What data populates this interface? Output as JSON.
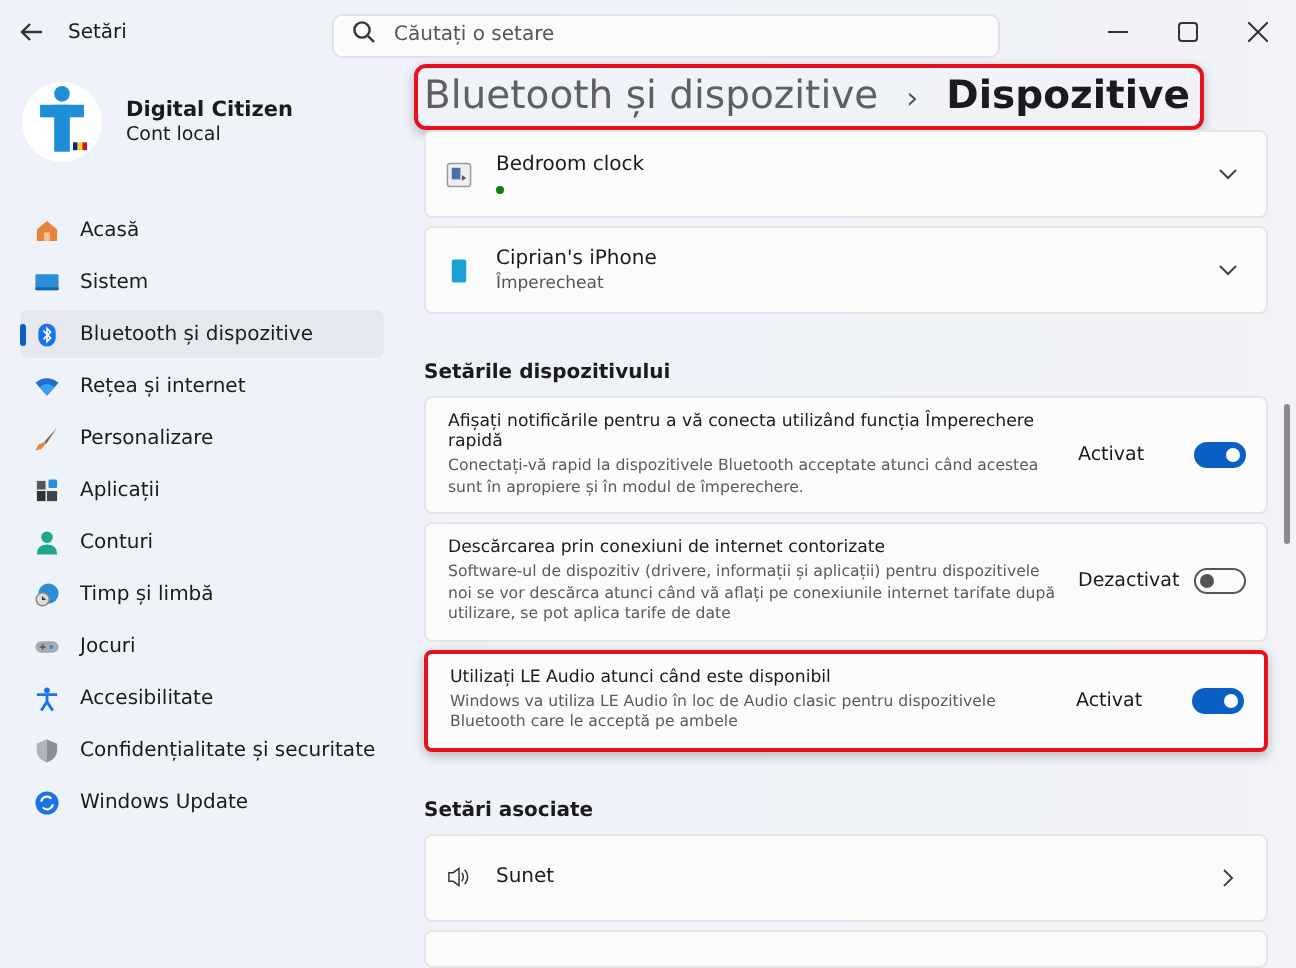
{
  "window": {
    "title": "Setări"
  },
  "search": {
    "placeholder": "Căutați o setare"
  },
  "profile": {
    "name": "Digital Citizen",
    "account": "Cont local"
  },
  "sidebar": {
    "items": [
      {
        "label": "Acasă",
        "kind": "home",
        "selected": false
      },
      {
        "label": "Sistem",
        "kind": "system",
        "selected": false
      },
      {
        "label": "Bluetooth și dispozitive",
        "kind": "bluetooth",
        "selected": true
      },
      {
        "label": "Rețea și internet",
        "kind": "wifi",
        "selected": false
      },
      {
        "label": "Personalizare",
        "kind": "brush",
        "selected": false
      },
      {
        "label": "Aplicații",
        "kind": "apps",
        "selected": false
      },
      {
        "label": "Conturi",
        "kind": "person",
        "selected": false
      },
      {
        "label": "Timp și limbă",
        "kind": "globe",
        "selected": false
      },
      {
        "label": "Jocuri",
        "kind": "gamepad",
        "selected": false
      },
      {
        "label": "Accesibilitate",
        "kind": "access",
        "selected": false
      },
      {
        "label": "Confidențialitate și securitate",
        "kind": "shield",
        "selected": false
      },
      {
        "label": "Windows Update",
        "kind": "update",
        "selected": false
      }
    ]
  },
  "breadcrumb": {
    "parent": "Bluetooth și dispozitive",
    "separator": "›",
    "current": "Dispozitive",
    "highlighted": true
  },
  "devices": [
    {
      "name": "Bedroom clock",
      "kind": "clock",
      "color": "#107c10"
    },
    {
      "name": "Ciprian's iPhone",
      "kind": "phone",
      "status": "Împerecheat"
    }
  ],
  "device_settings": {
    "heading": "Setările dispozitivului",
    "items": [
      {
        "title": "Afișați notificările pentru a vă conecta utilizând funcția Împerechere rapidă",
        "description": "Conectați-vă rapid la dispozitivele Bluetooth acceptate atunci când acestea sunt în apropiere și în modul de împerechere.",
        "state_label": "Activat",
        "on": true,
        "highlighted": false
      },
      {
        "title": "Descărcarea prin conexiuni de internet contorizate",
        "description": "Software-ul de dispozitiv (drivere, informații și aplicații) pentru dispozitivele noi se vor descărca atunci când vă aflați pe conexiunile internet tarifate după utilizare, se pot aplica tarife de date",
        "state_label": "Dezactivat",
        "on": false,
        "highlighted": false
      },
      {
        "title": "Utilizați LE Audio atunci când este disponibil",
        "description": "Windows va utiliza LE Audio în loc de Audio clasic pentru dispozitivele Bluetooth care le acceptă pe ambele",
        "state_label": "Activat",
        "on": true,
        "highlighted": true
      }
    ]
  },
  "related": {
    "heading": "Setări asociate",
    "items": [
      {
        "label": "Sunet",
        "kind": "speaker"
      }
    ]
  }
}
